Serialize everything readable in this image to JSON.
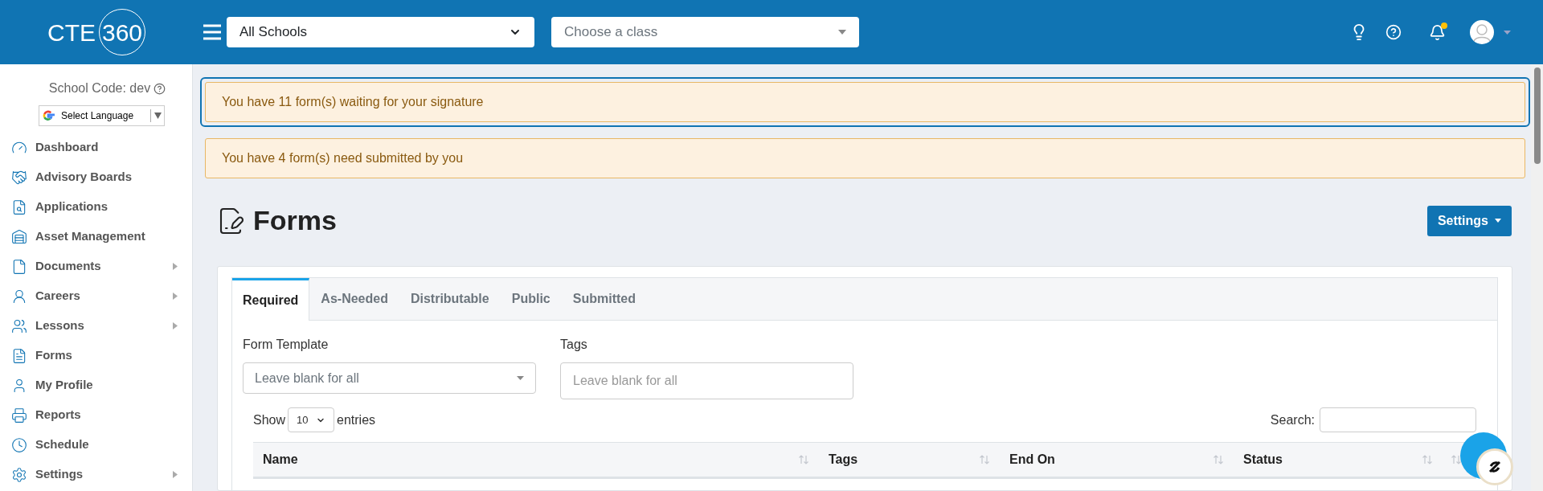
{
  "header": {
    "logo": {
      "text": "CTE",
      "circled": "360"
    },
    "school_select": {
      "value": "All Schools"
    },
    "class_select": {
      "placeholder": "Choose a class"
    },
    "notifications": {
      "unread": true
    }
  },
  "sidebar": {
    "school_code": "School Code: dev",
    "language_button": "Select Language",
    "items": [
      {
        "label": "Dashboard",
        "has_submenu": false
      },
      {
        "label": "Advisory Boards",
        "has_submenu": false
      },
      {
        "label": "Applications",
        "has_submenu": false
      },
      {
        "label": "Asset Management",
        "has_submenu": false
      },
      {
        "label": "Documents",
        "has_submenu": true
      },
      {
        "label": "Careers",
        "has_submenu": true
      },
      {
        "label": "Lessons",
        "has_submenu": true
      },
      {
        "label": "Forms",
        "has_submenu": false
      },
      {
        "label": "My Profile",
        "has_submenu": false
      },
      {
        "label": "Reports",
        "has_submenu": false
      },
      {
        "label": "Schedule",
        "has_submenu": false
      },
      {
        "label": "Settings",
        "has_submenu": true
      }
    ]
  },
  "alerts": [
    {
      "text": "You have 11 form(s) waiting for your signature",
      "focused": true
    },
    {
      "text": "You have 4 form(s) need submitted by you",
      "focused": false
    }
  ],
  "page": {
    "title": "Forms",
    "settings_button": "Settings"
  },
  "tabs": [
    {
      "label": "Required",
      "selected": true
    },
    {
      "label": "As-Needed",
      "selected": false
    },
    {
      "label": "Distributable",
      "selected": false
    },
    {
      "label": "Public",
      "selected": false
    },
    {
      "label": "Submitted",
      "selected": false
    }
  ],
  "filters": {
    "form_template": {
      "label": "Form Template",
      "placeholder": "Leave blank for all"
    },
    "tags": {
      "label": "Tags",
      "placeholder": "Leave blank for all"
    }
  },
  "table": {
    "show_label": "Show",
    "page_size": "10",
    "entries_label": "entries",
    "search_label": "Search:",
    "columns": [
      {
        "label": "Name"
      },
      {
        "label": "Tags"
      },
      {
        "label": "End On"
      },
      {
        "label": "Status"
      }
    ]
  }
}
